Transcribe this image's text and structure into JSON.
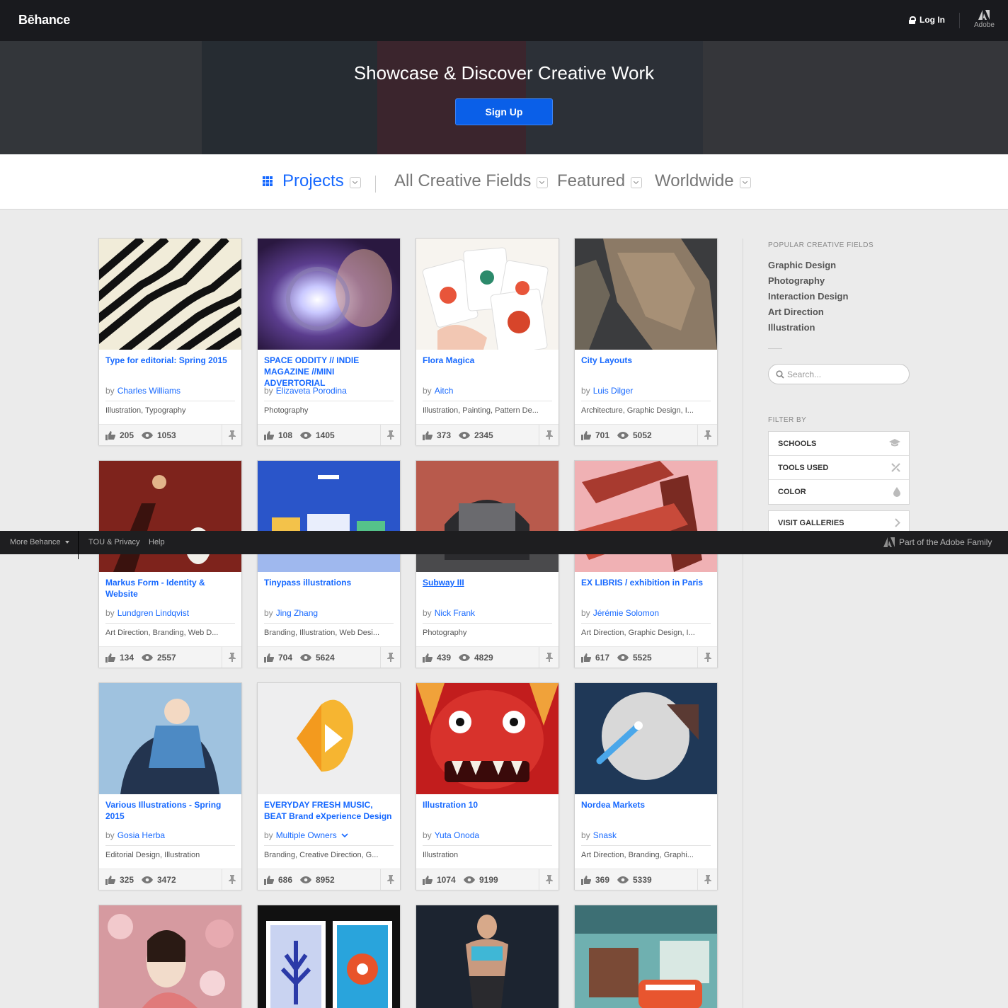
{
  "header": {
    "logo": "Bēhance",
    "login_label": "Log In",
    "adobe_label": "Adobe"
  },
  "hero": {
    "title": "Showcase & Discover Creative Work",
    "signup_label": "Sign Up"
  },
  "filters": {
    "content_type": "Projects",
    "creative_field": "All Creative Fields",
    "sort": "Featured",
    "location": "Worldwide"
  },
  "projects": [
    {
      "title": "Type for editorial: Spring 2015",
      "owner": "Charles Williams",
      "fields": "Illustration, Typography",
      "appreciations": "205",
      "views": "1053"
    },
    {
      "title": "SPACE ODDITY // INDIE MAGAZINE //MINI ADVERTORIAL",
      "owner": "Elizaveta Porodina",
      "fields": "Photography",
      "appreciations": "108",
      "views": "1405"
    },
    {
      "title": "Flora Magica",
      "owner": "Aitch",
      "fields": "Illustration, Painting, Pattern De...",
      "appreciations": "373",
      "views": "2345"
    },
    {
      "title": "City Layouts",
      "owner": "Luis Dilger",
      "fields": "Architecture, Graphic Design, I...",
      "appreciations": "701",
      "views": "5052"
    },
    {
      "title": "Markus Form - Identity & Website",
      "owner": "Lundgren Lindqvist",
      "fields": "Art Direction, Branding, Web D...",
      "appreciations": "134",
      "views": "2557"
    },
    {
      "title": "Tinypass illustrations",
      "owner": "Jing Zhang",
      "fields": "Branding, Illustration, Web Desi...",
      "appreciations": "704",
      "views": "5624"
    },
    {
      "title": "Subway III",
      "owner": "Nick Frank",
      "fields": "Photography",
      "appreciations": "439",
      "views": "4829"
    },
    {
      "title": "EX LIBRIS / exhibition in Paris",
      "owner": "Jérémie Solomon",
      "fields": "Art Direction, Graphic Design, I...",
      "appreciations": "617",
      "views": "5525"
    },
    {
      "title": "Various Illustrations - Spring 2015",
      "owner": "Gosia Herba",
      "fields": "Editorial Design, Illustration",
      "appreciations": "325",
      "views": "3472"
    },
    {
      "title": "EVERYDAY FRESH MUSIC, BEAT Brand eXperience Design",
      "owner": "Multiple Owners",
      "fields": "Branding, Creative Direction, G...",
      "appreciations": "686",
      "views": "8952"
    },
    {
      "title": "Illustration 10",
      "owner": "Yuta Onoda",
      "fields": "Illustration",
      "appreciations": "1074",
      "views": "9199"
    },
    {
      "title": "Nordea Markets",
      "owner": "Snask",
      "fields": "Art Direction, Branding, Graphi...",
      "appreciations": "369",
      "views": "5339"
    }
  ],
  "by_label": "by",
  "sidebar": {
    "popular_heading": "POPULAR CREATIVE FIELDS",
    "popular_fields": [
      "Graphic Design",
      "Photography",
      "Interaction Design",
      "Art Direction",
      "Illustration"
    ],
    "search_placeholder": "Search...",
    "filter_heading": "FILTER BY",
    "filter_schools": "SCHOOLS",
    "filter_tools": "TOOLS USED",
    "filter_color": "COLOR",
    "visit_galleries": "VISIT GALLERIES"
  },
  "footer": {
    "more_behance": "More Behance",
    "tou": "TOU & Privacy",
    "help": "Help",
    "adobe_family": "Part of the Adobe Family"
  },
  "colors": {
    "accent": "#1769ff",
    "topbar": "#191a1e",
    "signup": "#0a5fe8",
    "background": "#ebebeb"
  }
}
